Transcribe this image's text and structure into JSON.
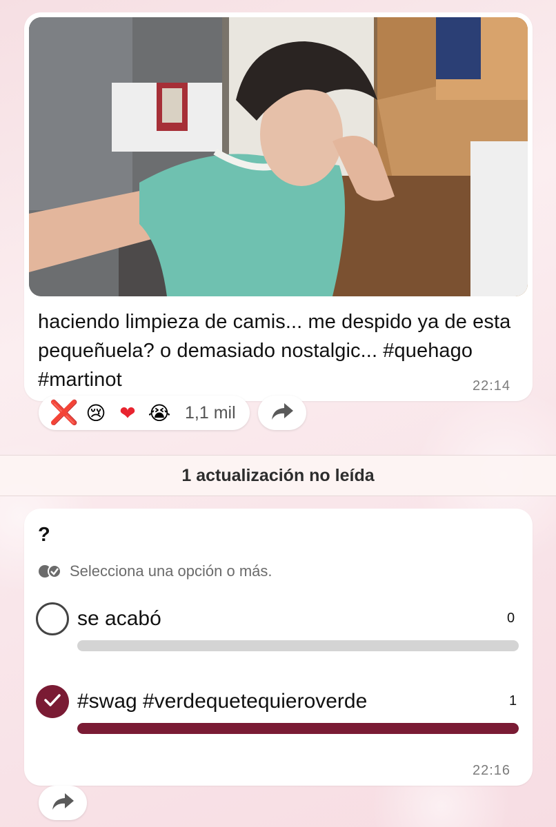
{
  "post": {
    "text": "haciendo limpieza de camis... me despido ya de esta pequeñuela? o demasiado nostalgic... #quehago #martinot",
    "time": "22:14",
    "photo_icon": "photo-selfie-mint-tshirt"
  },
  "reactions": {
    "items": [
      {
        "icon": "cross-mark-icon",
        "glyph": "❌"
      },
      {
        "icon": "crying-face-icon",
        "glyph": "😢"
      },
      {
        "icon": "red-heart-icon",
        "glyph": "❤"
      },
      {
        "icon": "loudly-crying-face-icon",
        "glyph": "😭"
      }
    ],
    "count": "1,1 mil"
  },
  "unread": {
    "label": "1 actualización no leída"
  },
  "poll": {
    "question": "?",
    "hint": "Selecciona una opción o más.",
    "time": "22:16",
    "accent_color": "#7a1b34",
    "options": [
      {
        "label": "se acabó",
        "votes": "0",
        "selected": false,
        "fill": 0
      },
      {
        "label": "#swag #verdequetequieroverde",
        "votes": "1",
        "selected": true,
        "fill": 1
      }
    ]
  }
}
